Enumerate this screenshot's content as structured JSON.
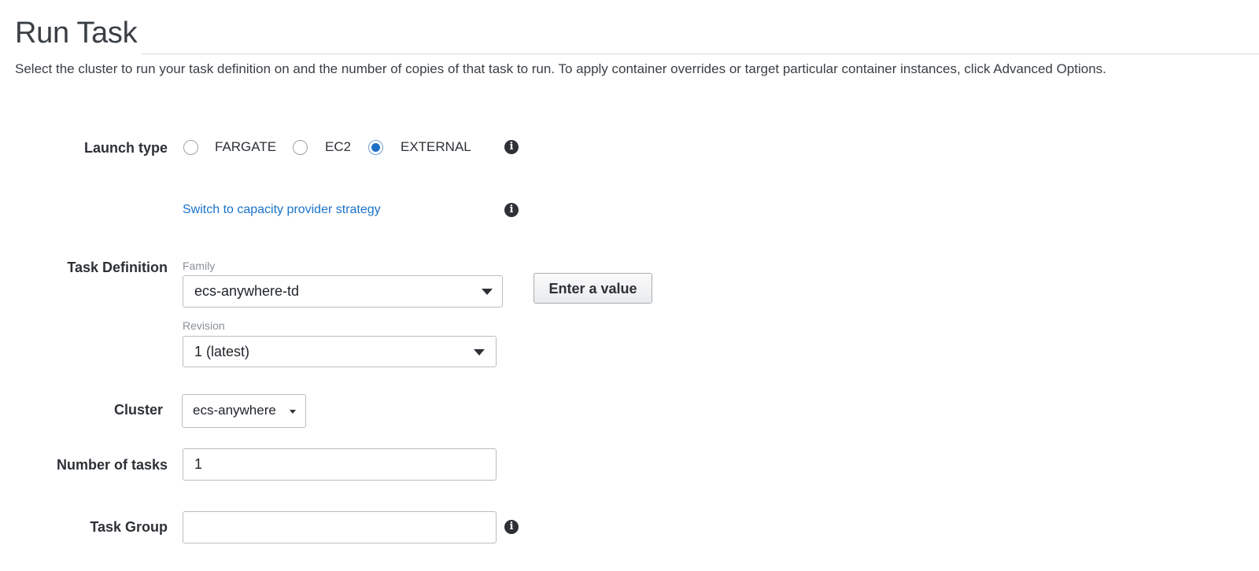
{
  "header": {
    "title": "Run Task",
    "description": "Select the cluster to run your task definition on and the number of copies of that task to run. To apply container overrides or target particular container instances, click Advanced Options."
  },
  "form": {
    "launch_type": {
      "label": "Launch type",
      "options": [
        {
          "label": "FARGATE",
          "selected": false
        },
        {
          "label": "EC2",
          "selected": false
        },
        {
          "label": "EXTERNAL",
          "selected": true
        }
      ],
      "info_icon": "info-icon"
    },
    "capacity_link": {
      "text": "Switch to capacity provider strategy",
      "info_icon": "info-icon"
    },
    "task_definition": {
      "label": "Task Definition",
      "family_caption": "Family",
      "family_value": "ecs-anywhere-td",
      "revision_caption": "Revision",
      "revision_value": "1 (latest)",
      "enter_value_button": "Enter a value"
    },
    "cluster": {
      "label": "Cluster",
      "value": "ecs-anywhere"
    },
    "number_of_tasks": {
      "label": "Number of tasks",
      "value": "1"
    },
    "task_group": {
      "label": "Task Group",
      "value": "",
      "info_icon": "info-icon"
    }
  },
  "colors": {
    "link": "#1a73c8",
    "radio_selected": "#1c6fc4"
  }
}
